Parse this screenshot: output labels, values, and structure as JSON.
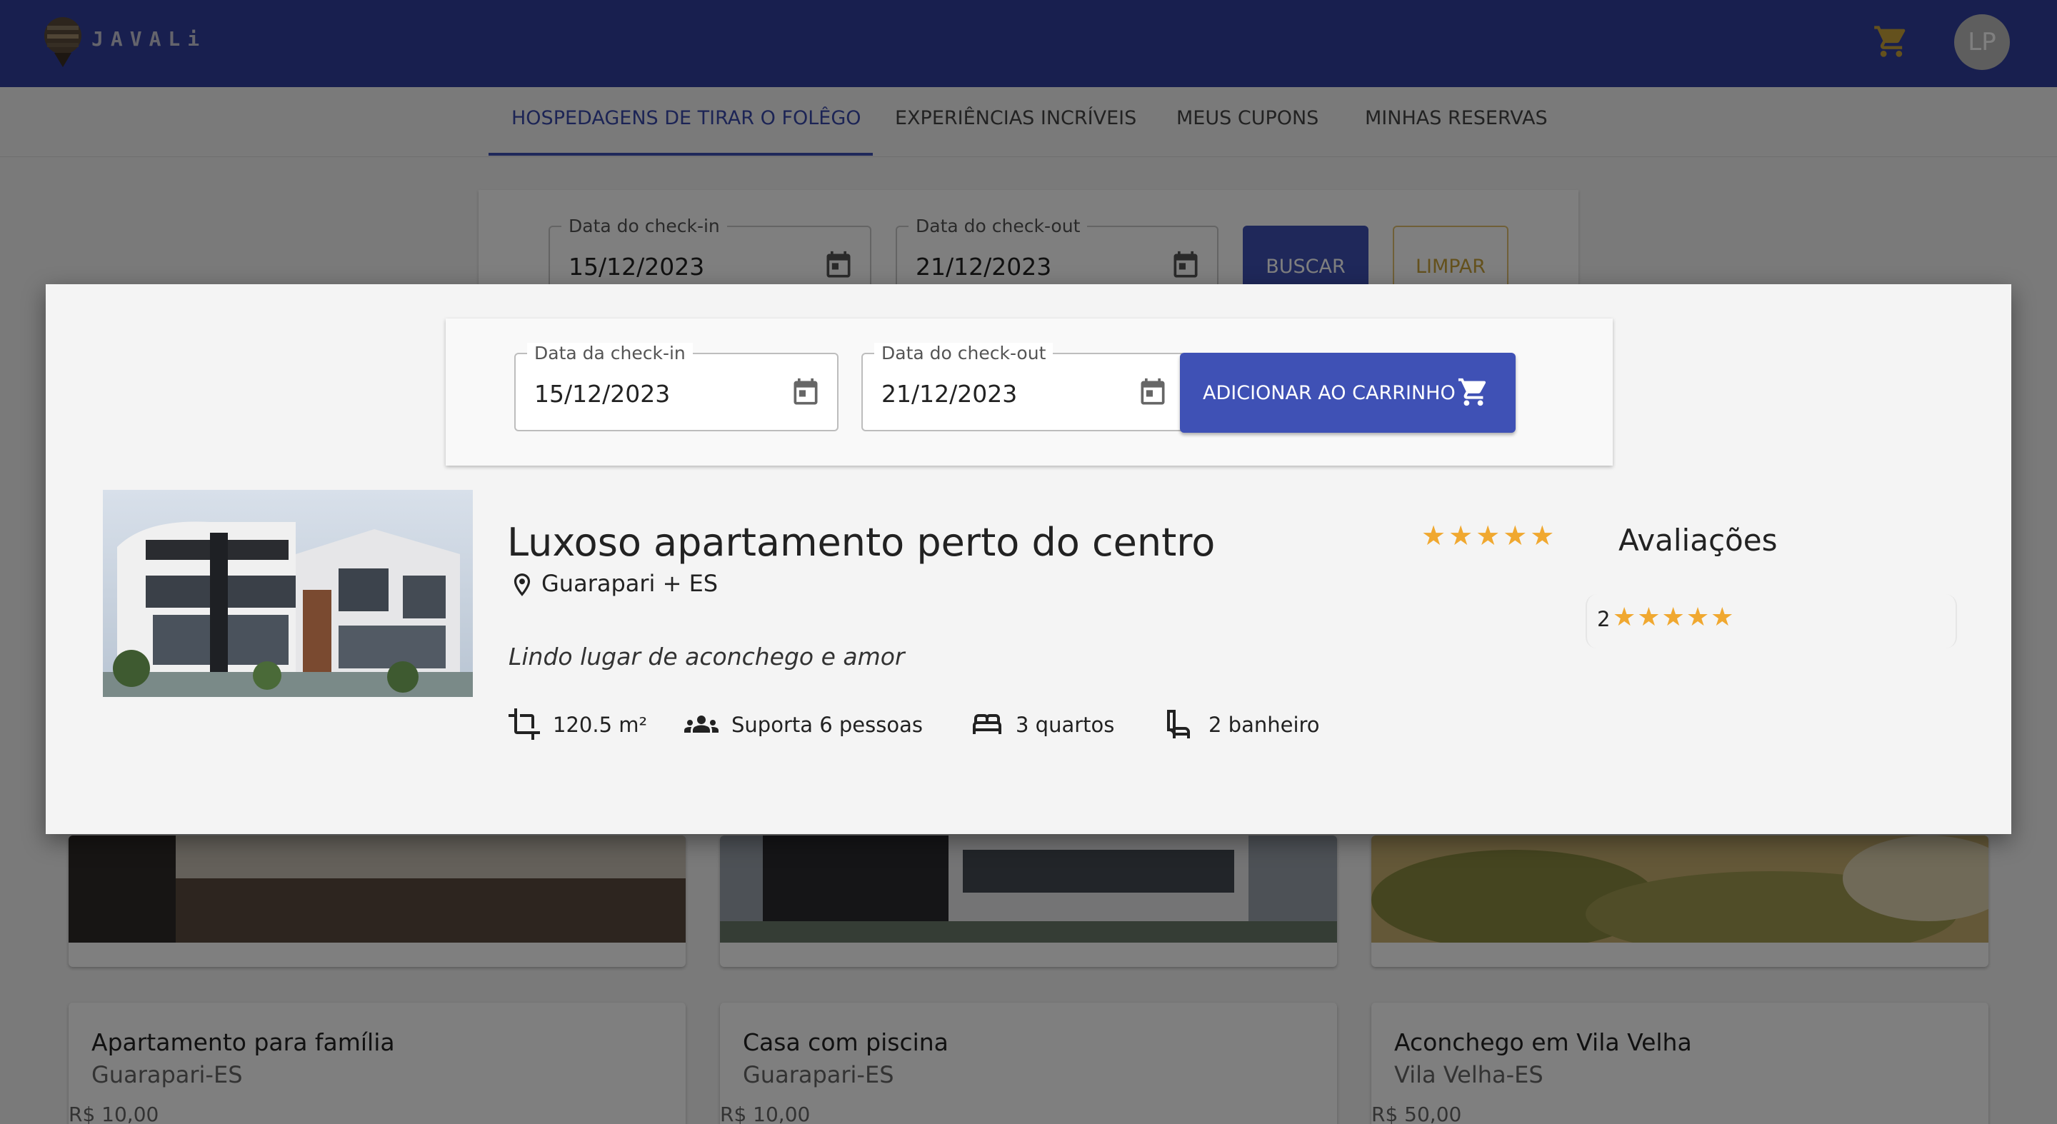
{
  "app": {
    "brand": "JAVALi",
    "avatar_initials": "LP",
    "accent_color": "#303f9f"
  },
  "nav": {
    "tabs": [
      {
        "label": "HOSPEDAGENS DE TIRAR O FOLÊGO",
        "active": true
      },
      {
        "label": "EXPERIÊNCIAS INCRÍVEIS",
        "active": false
      },
      {
        "label": "MEUS CUPONS",
        "active": false
      },
      {
        "label": "MINHAS RESERVAS",
        "active": false
      }
    ]
  },
  "search": {
    "checkin_label": "Data do check-in",
    "checkin_value": "15/12/2023",
    "checkout_label": "Data do check-out",
    "checkout_value": "21/12/2023",
    "search_button": "BUSCAR",
    "clear_button": "LIMPAR"
  },
  "listings": [
    {
      "title": "Apartamento para família",
      "location": "Guarapari-ES",
      "price": "R$ 10,00"
    },
    {
      "title": "Casa com piscina",
      "location": "Guarapari-ES",
      "price": "R$ 10,00"
    },
    {
      "title": "Aconchego em Vila Velha",
      "location": "Vila Velha-ES",
      "price": "R$ 50,00"
    }
  ],
  "dialog": {
    "booking": {
      "checkin_label": "Data da check-in",
      "checkin_value": "15/12/2023",
      "checkout_label": "Data do check-out",
      "checkout_value": "21/12/2023",
      "add_to_cart": "ADICIONAR AO CARRINHO"
    },
    "property": {
      "title": "Luxoso apartamento perto do centro",
      "location": "Guarapari + ES",
      "description": "Lindo lugar de aconchego e amor",
      "rating": 5,
      "features": {
        "area": "120.5 m²",
        "guests": "Suporta 6 pessoas",
        "bedrooms": "3 quartos",
        "bathrooms": "2 banheiro"
      }
    },
    "reviews": {
      "title": "Avaliações",
      "items": [
        {
          "number": "2",
          "stars": 5
        }
      ]
    },
    "star_color": "#f0a830"
  }
}
